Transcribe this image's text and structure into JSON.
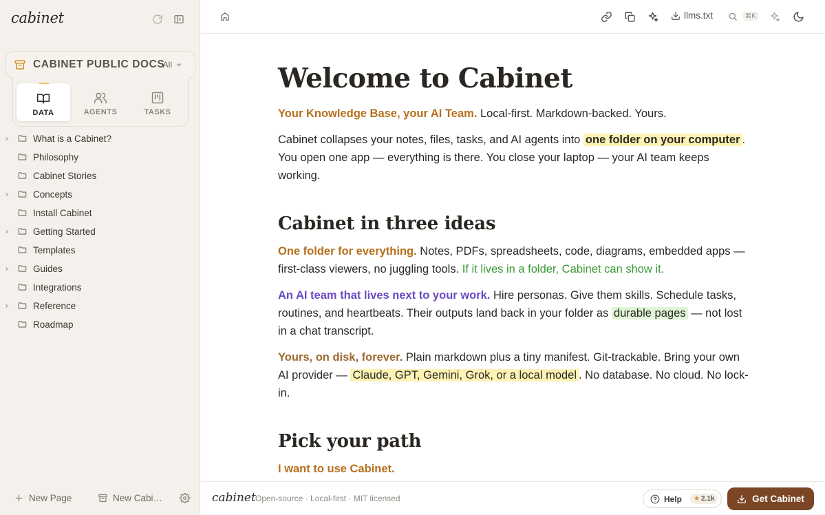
{
  "sidebar": {
    "brand": "cabinet",
    "cabinet_name": "CABINET PUBLIC DOCS",
    "cabinet_filter": "All",
    "tabs": [
      {
        "label": "DATA",
        "icon": "book-icon",
        "active": true
      },
      {
        "label": "AGENTS",
        "icon": "users-icon",
        "active": false
      },
      {
        "label": "TASKS",
        "icon": "kanban-icon",
        "active": false
      }
    ],
    "tree": [
      {
        "label": "What is a Cabinet?",
        "expandable": true
      },
      {
        "label": "Philosophy",
        "expandable": false
      },
      {
        "label": "Cabinet Stories",
        "expandable": false
      },
      {
        "label": "Concepts",
        "expandable": true
      },
      {
        "label": "Install Cabinet",
        "expandable": false
      },
      {
        "label": "Getting Started",
        "expandable": true
      },
      {
        "label": "Templates",
        "expandable": false
      },
      {
        "label": "Guides",
        "expandable": true
      },
      {
        "label": "Integrations",
        "expandable": false
      },
      {
        "label": "Reference",
        "expandable": true
      },
      {
        "label": "Roadmap",
        "expandable": false
      }
    ],
    "new_page_label": "New Page",
    "new_cabinet_label": "New Cabi…"
  },
  "header": {
    "llms_label": "llms.txt",
    "search_shortcut": "⌘K"
  },
  "content": {
    "title": "Welcome to Cabinet",
    "tagline_lead": "Your Knowledge Base, your AI Team.",
    "tagline_rest": " Local-first. Markdown-backed. Yours.",
    "intro_1": "Cabinet collapses your notes, files, tasks, and AI agents into ",
    "intro_hl": "one folder on your computer",
    "intro_2": ". You open one app — everything is there. You close your laptop — your AI team keeps working.",
    "section1_title": "Cabinet in three ideas",
    "idea1_lead": "One folder for everything.",
    "idea1_text": " Notes, PDFs, spreadsheets, code, diagrams, embedded apps — first-class viewers, no juggling tools. ",
    "idea1_green": "If it lives in a folder, Cabinet can show it.",
    "idea2_lead": "An AI team that lives next to your work.",
    "idea2_text": " Hire personas. Give them skills. Schedule tasks, routines, and heartbeats. Their outputs land back in your folder as ",
    "idea2_hl": "durable pages",
    "idea2_tail": " — not lost in a chat transcript.",
    "idea3_lead": "Yours, on disk, forever.",
    "idea3_text": " Plain markdown plus a tiny manifest. Git-trackable. Bring your own AI provider — ",
    "idea3_hl": "Claude, GPT, Gemini, Grok, or a local model",
    "idea3_tail": ". No database. No cloud. No lock-in.",
    "section2_title": "Pick your path",
    "path_lead": "I want to use Cabinet."
  },
  "footer": {
    "brand": "cabinet",
    "tagline": "Open-source · Local-first · MIT licensed",
    "help_label": "Help",
    "stars": "2.1k",
    "cta_label": "Get Cabinet"
  },
  "colors": {
    "accent_orange": "#b76f1d",
    "accent_purple": "#6a4bc4",
    "cta_brown": "#7a4626",
    "highlight_yellow": "#fdf3b4",
    "highlight_green": "#dff5d5",
    "tab_underline": "#f0c36b"
  }
}
